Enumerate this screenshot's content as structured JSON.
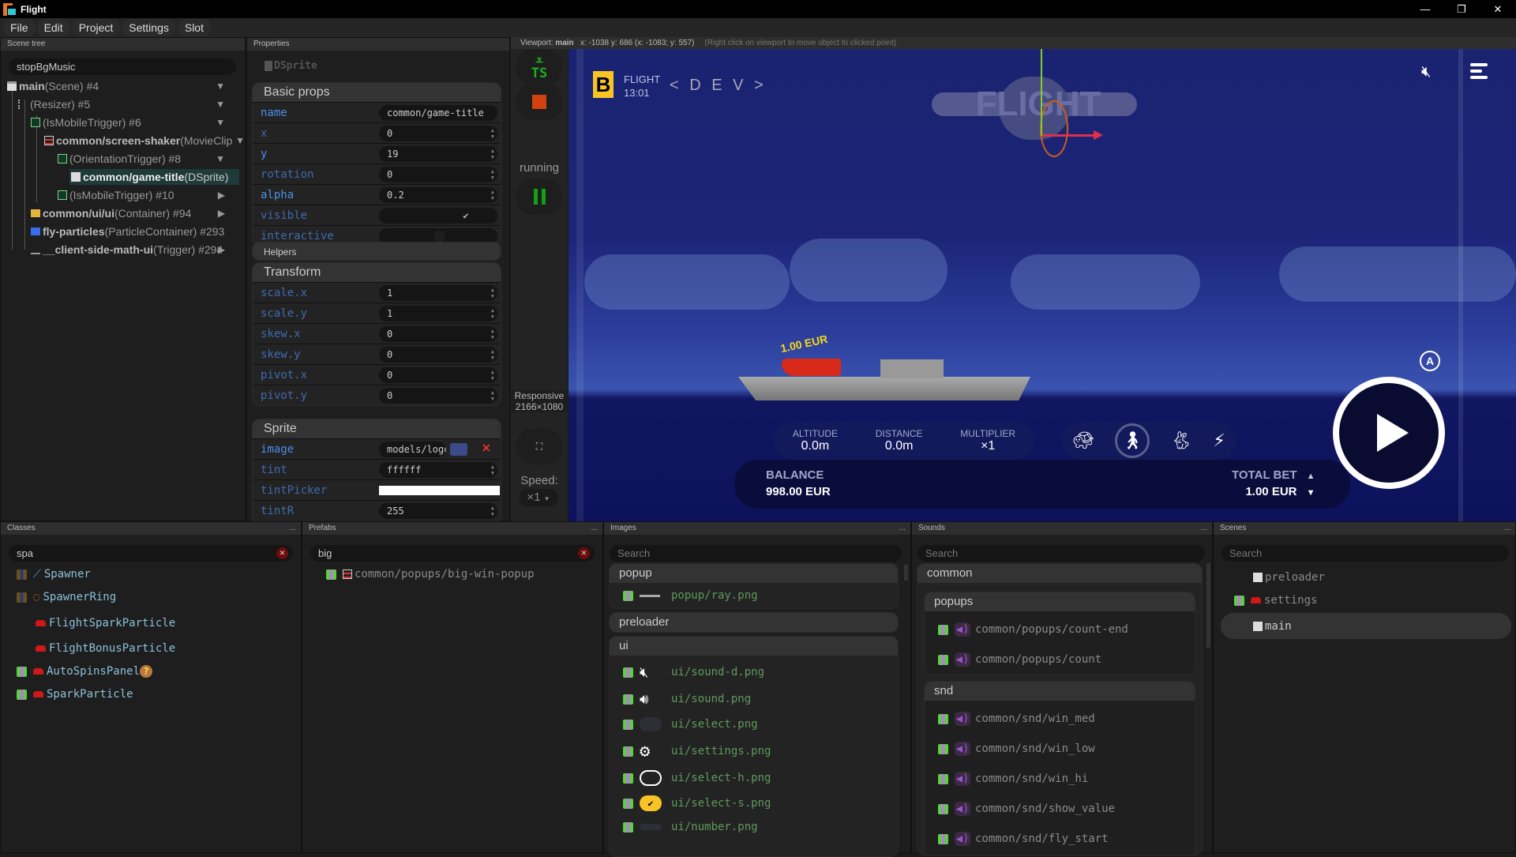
{
  "window": {
    "title": "Flight",
    "controls": [
      "minimize",
      "restore",
      "close"
    ]
  },
  "menu": [
    "File",
    "Edit",
    "Project",
    "Settings",
    "Slot"
  ],
  "scene_tree": {
    "title": "Scene tree",
    "search": "stopBgMusic",
    "items": [
      {
        "name": "main",
        "cls": "(Scene) #4",
        "icon": "scene-icon",
        "expanded": true
      },
      {
        "name": "",
        "cls": "(Resizer) #5",
        "icon": "resizer-icon",
        "expanded": true
      },
      {
        "name": "",
        "cls": "(IsMobileTrigger) #6",
        "icon": "mobile-trigger-icon",
        "expanded": true
      },
      {
        "name": "common/screen-shaker",
        "cls": "(MovieClip",
        "icon": "movieclip-icon",
        "expanded": true
      },
      {
        "name": "",
        "cls": "(OrientationTrigger) #8",
        "icon": "orientation-trigger-icon",
        "expanded": true
      },
      {
        "name": "common/game-title",
        "cls": "(DSprite)",
        "icon": "sprite-icon",
        "selected": true
      },
      {
        "name": "",
        "cls": "(IsMobileTrigger) #10",
        "icon": "mobile-trigger-icon",
        "expanded": false
      },
      {
        "name": "common/ui/ui",
        "cls": "(Container) #94",
        "icon": "folder-icon",
        "expanded": false
      },
      {
        "name": "fly-particles",
        "cls": "(ParticleContainer) #293",
        "icon": "particle-folder-icon"
      },
      {
        "name": "__client-side-math-ui",
        "cls": "(Trigger) #294",
        "icon": "trigger-icon",
        "expanded": false
      }
    ]
  },
  "properties": {
    "title": "Properties",
    "type": "DSprite",
    "sections": {
      "basic": {
        "title": "Basic props",
        "rows": [
          {
            "name": "name",
            "value": "common/game-title",
            "hi": true
          },
          {
            "name": "x",
            "value": "0"
          },
          {
            "name": "y",
            "value": "19",
            "hi": true
          },
          {
            "name": "rotation",
            "value": "0"
          },
          {
            "name": "alpha",
            "value": "0.2",
            "hi": true
          },
          {
            "name": "visible",
            "value": "✔",
            "checkbox": true,
            "checked": true
          },
          {
            "name": "interactive",
            "value": "",
            "checkbox": true,
            "checked": false
          }
        ]
      },
      "helpers": {
        "title": "Helpers"
      },
      "transform": {
        "title": "Transform",
        "rows": [
          {
            "name": "scale.x",
            "value": "1"
          },
          {
            "name": "scale.y",
            "value": "1"
          },
          {
            "name": "skew.x",
            "value": "0"
          },
          {
            "name": "skew.y",
            "value": "0"
          },
          {
            "name": "pivot.x",
            "value": "0"
          },
          {
            "name": "pivot.y",
            "value": "0"
          }
        ]
      },
      "sprite": {
        "title": "Sprite",
        "rows": [
          {
            "name": "image",
            "value": "models/logo",
            "hi": true
          },
          {
            "name": "tint",
            "value": "ffffff"
          },
          {
            "name": "tintPicker",
            "value": "#ffffff"
          },
          {
            "name": "tintR",
            "value": "255"
          }
        ]
      }
    }
  },
  "tools": {
    "status": "running",
    "responsive": "Responsive",
    "resolution": "2166×1080",
    "speed_label": "Speed:",
    "speed_value": "×1"
  },
  "viewport": {
    "label": "Viewport:",
    "scene": "main",
    "coords": "x: -1038 y: 686 (x: -1083; y: 557)",
    "hint": "(Right click on viewport to move object to clicked point)"
  },
  "game": {
    "brand": "B",
    "title": "FLIGHT",
    "time": "13:01",
    "dev": "< D E V >",
    "logo_text": "FLIGHT",
    "plane_bet": "1.00 EUR",
    "stats": [
      {
        "label": "ALTITUDE",
        "value": "0.0m"
      },
      {
        "label": "DISTANCE",
        "value": "0.0m"
      },
      {
        "label": "MULTIPLIER",
        "value": "×1"
      }
    ],
    "speeds": [
      "turtle",
      "walk",
      "rabbit",
      "lightning"
    ],
    "selected_speed": "walk",
    "balance_label": "BALANCE",
    "balance_value": "998.00 EUR",
    "bet_label": "TOTAL BET",
    "bet_value": "1.00 EUR"
  },
  "classes": {
    "title": "Classes",
    "search": "spa",
    "items": [
      {
        "name": "Spawner"
      },
      {
        "name": "SpawnerRing"
      },
      {
        "name": "FlightSparkParticle"
      },
      {
        "name": "FlightBonusParticle"
      },
      {
        "name": "AutoSpinsPanel"
      },
      {
        "name": "SparkParticle"
      }
    ]
  },
  "prefabs": {
    "title": "Prefabs",
    "search": "big",
    "items": [
      "common/popups/big-win-popup"
    ]
  },
  "images": {
    "title": "Images",
    "search_placeholder": "Search",
    "groups": [
      {
        "name": "popup",
        "items": [
          "popup/ray.png"
        ]
      },
      {
        "name": "preloader",
        "items": []
      },
      {
        "name": "ui",
        "items": [
          "ui/sound-d.png",
          "ui/sound.png",
          "ui/select.png",
          "ui/settings.png",
          "ui/select-h.png",
          "ui/select-s.png",
          "ui/number.png"
        ]
      }
    ]
  },
  "sounds": {
    "title": "Sounds",
    "search_placeholder": "Search",
    "root": "common",
    "groups": [
      {
        "name": "popups",
        "items": [
          "common/popups/count-end",
          "common/popups/count"
        ]
      },
      {
        "name": "snd",
        "items": [
          "common/snd/win_med",
          "common/snd/win_low",
          "common/snd/win_hi",
          "common/snd/show_value",
          "common/snd/fly_start"
        ]
      }
    ]
  },
  "scenes": {
    "title": "Scenes",
    "search_placeholder": "Search",
    "items": [
      "preloader",
      "settings",
      "main"
    ],
    "selected": "main"
  },
  "panel_menu": "..."
}
